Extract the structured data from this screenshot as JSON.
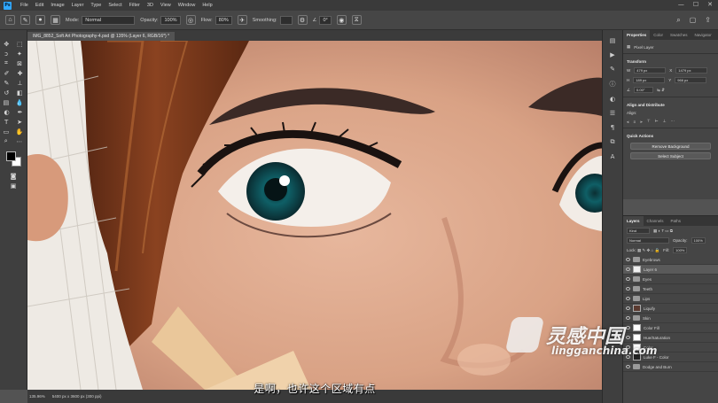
{
  "menubar": {
    "logo": "Ps",
    "items": [
      "File",
      "Edit",
      "Image",
      "Layer",
      "Type",
      "Select",
      "Filter",
      "3D",
      "View",
      "Window",
      "Help"
    ]
  },
  "options": {
    "mode_label": "Mode:",
    "mode_value": "Normal",
    "opacity_label": "Opacity:",
    "opacity_value": "100%",
    "flow_label": "Flow:",
    "flow_value": "80%",
    "smoothing_label": "Smoothing:",
    "angle_value": "0°"
  },
  "document": {
    "tab_title": "IMG_8852_Soft Art Photography-4.psd @ 135% (Layer 6, RGB/16*) *"
  },
  "status": {
    "zoom": "135.96%",
    "doc_size": "5400 px x 3600 px (300 ppi)"
  },
  "subtitle": "是啊，也许这个区域有点",
  "properties": {
    "tabs": [
      "Properties",
      "Color",
      "Swatches",
      "Navigator"
    ],
    "kind": "Pixel Layer",
    "transform_title": "Transform",
    "w": "479 px",
    "x": "1479 px",
    "h": "189 px",
    "y": "966 px",
    "angle": "0.00°",
    "align_title": "Align and Distribute",
    "align_label": "Align:",
    "quick_title": "Quick Actions",
    "remove_bg": "Remove Background",
    "select_subject": "Select Subject"
  },
  "layers": {
    "tabs": [
      "Layers",
      "Channels",
      "Paths"
    ],
    "kind_filter": "Kind",
    "blend_mode": "Normal",
    "opacity_label": "Opacity:",
    "opacity_value": "100%",
    "fill_label": "Fill:",
    "fill_value": "100%",
    "items": [
      {
        "name": "Eyebrows",
        "type": "folder"
      },
      {
        "name": "Layer 6",
        "type": "layer"
      },
      {
        "name": "Eyes",
        "type": "folder"
      },
      {
        "name": "Teeth",
        "type": "folder"
      },
      {
        "name": "Lips",
        "type": "folder"
      },
      {
        "name": "Liquify",
        "type": "layer"
      },
      {
        "name": "Skin",
        "type": "folder"
      },
      {
        "name": "Color Fill",
        "type": "layer"
      },
      {
        "name": "Hue/Saturation",
        "type": "layer"
      },
      {
        "name": "Color",
        "type": "layer"
      },
      {
        "name": "Luke F - Color",
        "type": "layer"
      },
      {
        "name": "Dodge and Burn",
        "type": "folder"
      }
    ]
  },
  "watermark": {
    "brand": "灵感中国",
    "url": "lingganchina.com"
  }
}
